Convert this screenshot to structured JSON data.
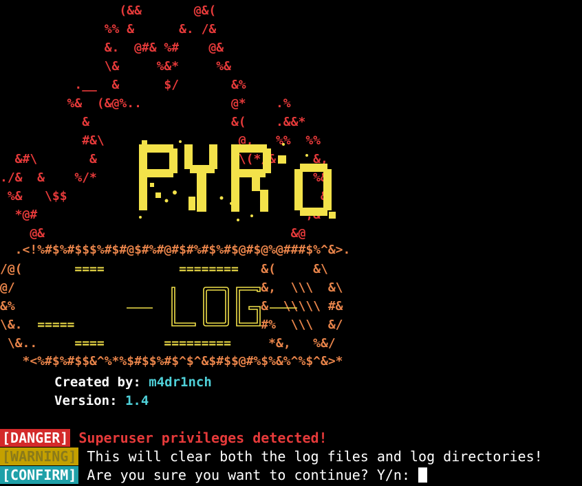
{
  "banner": {
    "flame": [
      {
        "text": "                (&&       @&(",
        "color": "red"
      },
      {
        "text": "              %% &      &. /&",
        "color": "red"
      },
      {
        "text": "              &.  @#& %#    @&",
        "color": "red"
      },
      {
        "text": "              \\&     %&*     %&",
        "color": "red"
      },
      {
        "text": "          .__  &      $/       &%",
        "color": "red"
      },
      {
        "text": "         %&  (&@%..            @*    .%",
        "color": "red"
      },
      {
        "text": "           &                   &(    .&&*",
        "color": "red"
      },
      {
        "text": "           #&\\                  @,   %%  %%",
        "color": "red"
      },
      {
        "text": "  &#\\       &                   \\(*/&     &,",
        "color": "red"
      },
      {
        "text": "./&  &    %/*                             %&",
        "color": "red"
      },
      {
        "text": " %&   \\$$                                  &",
        "color": "red"
      },
      {
        "text": "  *@#                                    ,&",
        "color": "red"
      },
      {
        "text": "    @&                                 &@",
        "color": "red"
      }
    ],
    "border_top": "  .<!%#$%#$$$%#$#@$#%#@#$#%#$%#$@#$@%@###$%^&>.",
    "frame": [
      {
        "left": "/@(",
        "bars": "       ====          ========   ",
        "right": "&(     &\\",
        "extra": ""
      },
      {
        "left": "@/ ",
        "bars": "                                ",
        "right": "&,  \\\\\\  &\\",
        "extra": ""
      },
      {
        "left": "&% ",
        "bars": "                                ",
        "right": "&  \\\\\\\\\\ #&",
        "extra": ""
      },
      {
        "left": "\\&.",
        "bars": "  =====                         ",
        "right": "#%  \\\\\\  &/",
        "extra": ""
      },
      {
        "left": " \\&..",
        "bars": "     ====        =========     ",
        "right": "*&,   %&/",
        "extra": ""
      }
    ],
    "border_bottom": "   *<%#$%#$$&^%*%$#$$%#$^$^&$#$$@#%$%&%^%$^&>*",
    "logo_text": "PYRO",
    "log_text": "LOG"
  },
  "info": {
    "created_label": "Created by: ",
    "created_value": "m4dr1nch",
    "version_label": "Version: ",
    "version_value": "1.4"
  },
  "messages": {
    "danger_tag": "[DANGER]",
    "danger_text": " Superuser privileges detected!",
    "warning_tag": "[WARNING]",
    "warning_text": " This will clear both the log files and log directories!",
    "confirm_tag": "[CONFIRM]",
    "confirm_text": " Are you sure you want to continue? Y/n: "
  },
  "colors": {
    "background": "#000000",
    "flame": "#e63a3a",
    "frame": "#e8844a",
    "logo": "#f3e24a",
    "accent": "#4fd0d8"
  }
}
